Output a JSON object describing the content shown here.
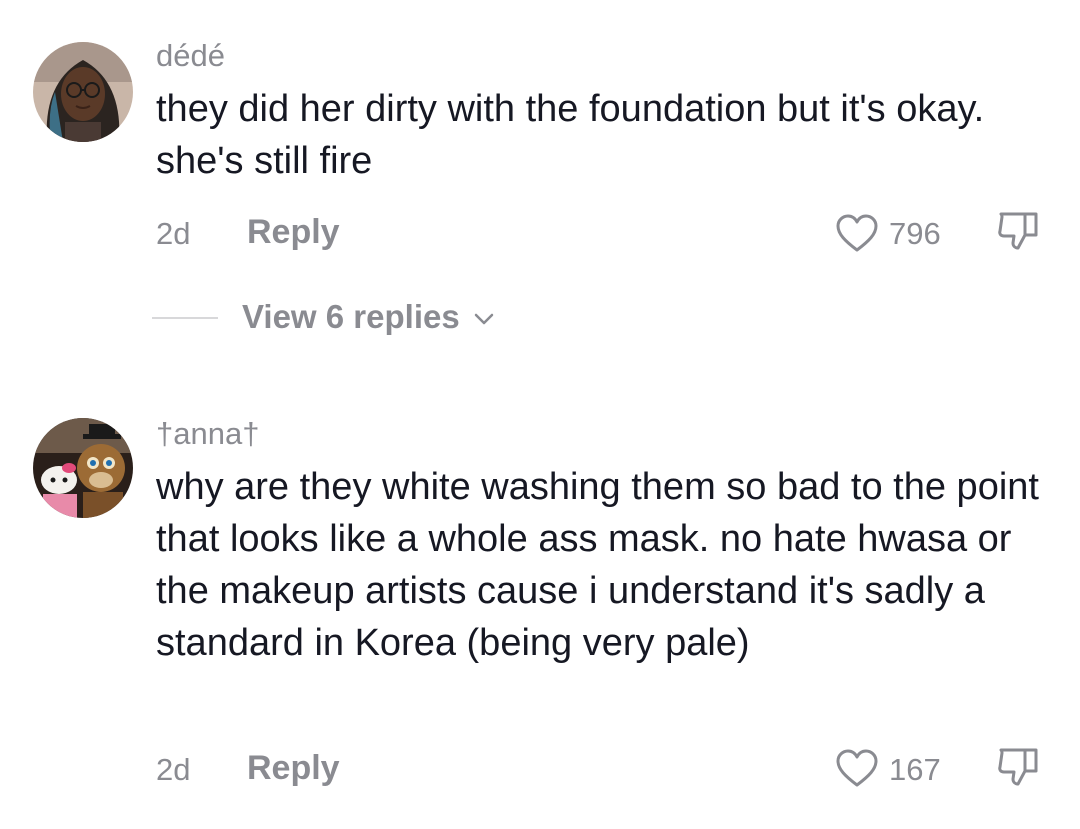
{
  "comments": [
    {
      "username": "dédé",
      "text": "they did her dirty with the foundation but it's okay. she's still fire",
      "time": "2d",
      "reply_label": "Reply",
      "likes": "796",
      "view_replies_label": "View 6 replies"
    },
    {
      "username": "†anna†",
      "text": "why are they white washing them so bad to the point that looks like a whole ass mask. no hate hwasa or the makeup artists cause i understand it's sadly a standard in Korea (being very pale)",
      "time": "2d",
      "reply_label": "Reply",
      "likes": "167"
    }
  ],
  "colors": {
    "text": "#161823",
    "muted": "#8a8b91",
    "divider": "#d8d8da"
  },
  "icons": [
    "heart-outline-icon",
    "thumbs-down-icon",
    "chevron-down-icon"
  ]
}
